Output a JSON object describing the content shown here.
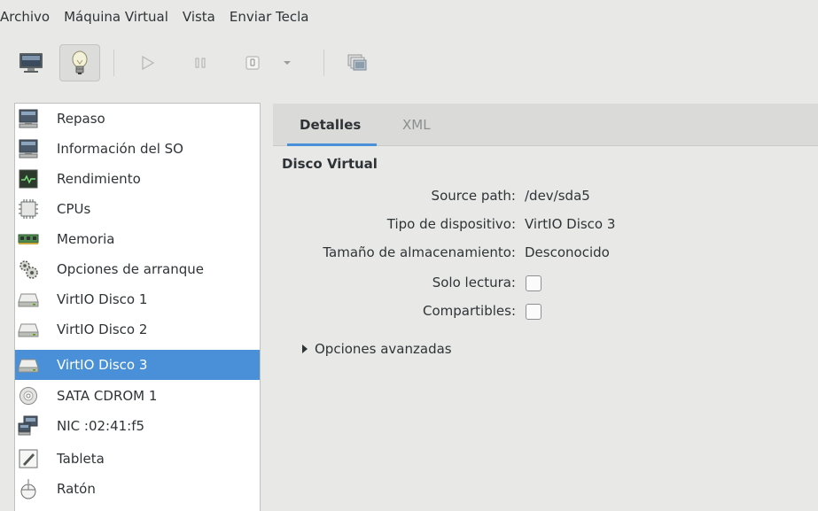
{
  "menubar": {
    "items": [
      "Archivo",
      "Máquina Virtual",
      "Vista",
      "Enviar Tecla"
    ]
  },
  "toolbar": {
    "buttons": [
      {
        "name": "console-view",
        "icon": "monitor-icon"
      },
      {
        "name": "details-view",
        "icon": "lightbulb-icon",
        "active": true
      },
      {
        "name": "run",
        "icon": "play-icon"
      },
      {
        "name": "pause",
        "icon": "pause-icon"
      },
      {
        "name": "shutdown",
        "icon": "power-icon"
      },
      {
        "name": "shutdown-menu",
        "icon": "chevron-down-icon"
      },
      {
        "name": "snapshots",
        "icon": "snapshot-icon"
      }
    ]
  },
  "sidebar": {
    "items": [
      {
        "label": "Repaso",
        "icon": "monitor-icon"
      },
      {
        "label": "Información del SO",
        "icon": "monitor-icon"
      },
      {
        "label": "Rendimiento",
        "icon": "performance-icon"
      },
      {
        "label": "CPUs",
        "icon": "cpu-icon"
      },
      {
        "label": "Memoria",
        "icon": "memory-icon"
      },
      {
        "label": "Opciones de arranque",
        "icon": "gears-icon"
      },
      {
        "label": "VirtIO Disco 1",
        "icon": "disk-icon"
      },
      {
        "label": "VirtIO Disco 2",
        "icon": "disk-icon"
      },
      {
        "label": "VirtIO Disco 3",
        "icon": "disk-icon",
        "selected": true
      },
      {
        "label": "SATA CDROM 1",
        "icon": "cdrom-icon"
      },
      {
        "label": "NIC :02:41:f5",
        "icon": "network-icon"
      },
      {
        "label": "Tableta",
        "icon": "tablet-icon"
      },
      {
        "label": "Ratón",
        "icon": "mouse-icon"
      }
    ]
  },
  "tabs": [
    {
      "label": "Detalles",
      "active": true
    },
    {
      "label": "XML",
      "active": false
    }
  ],
  "section": {
    "title": "Disco Virtual",
    "properties": [
      {
        "label": "Source path:",
        "value": "/dev/sda5"
      },
      {
        "label": "Tipo de dispositivo:",
        "value": "VirtIO Disco 3"
      },
      {
        "label": "Tamaño de almacenamiento:",
        "value": "Desconocido"
      },
      {
        "label": "Solo lectura:",
        "checked": false
      },
      {
        "label": "Compartibles:",
        "checked": false
      }
    ],
    "advanced_label": "Opciones avanzadas"
  },
  "colors": {
    "accent": "#4a90d9",
    "window_bg": "#e8e8e7",
    "text": "#2e3436"
  }
}
